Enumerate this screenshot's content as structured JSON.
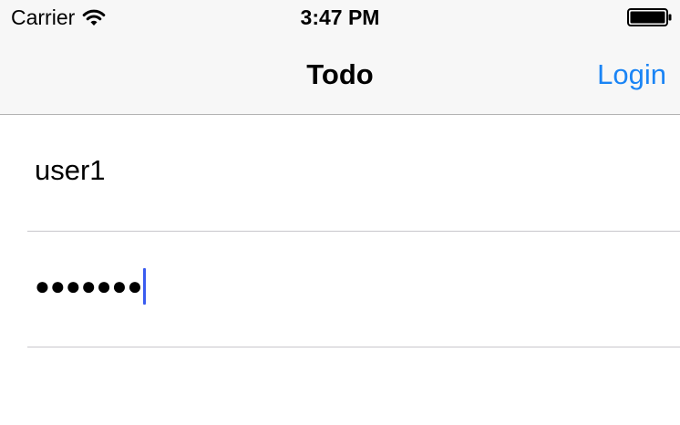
{
  "status_bar": {
    "carrier": "Carrier",
    "time": "3:47 PM",
    "wifi_icon": "wifi-icon",
    "battery_icon": "battery-icon"
  },
  "nav": {
    "title": "Todo",
    "login_label": "Login",
    "accent_color": "#1a84f5"
  },
  "form": {
    "username_value": "user1",
    "password_masked": "●●●●●●●",
    "caret_color": "#3a5cf0"
  }
}
